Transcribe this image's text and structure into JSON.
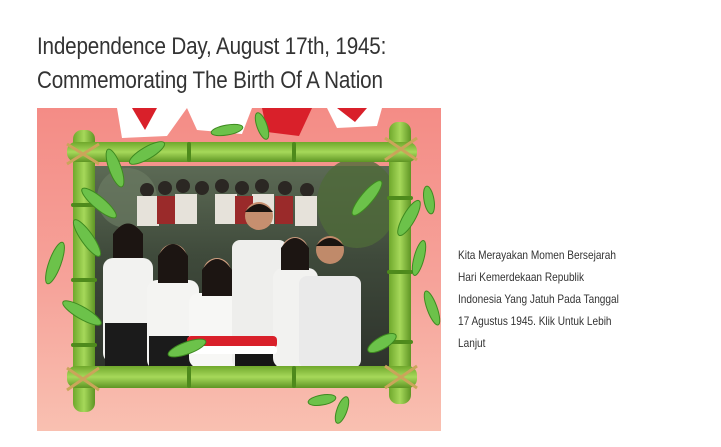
{
  "article": {
    "title_line1": "Independence Day, August 17th, 1945:",
    "title_line2": "Commemorating The Birth Of A Nation",
    "caption_lines": [
      "Kita Merayakan Momen Bersejarah",
      "Hari Kemerdekaan Republik",
      "Indonesia Yang Jatuh Pada Tanggal",
      "17 Agustus 1945. Klik Untuk Lebih",
      "Lanjut"
    ]
  },
  "image": {
    "subject": "students-holding-flag-in-bamboo-frame",
    "colors": {
      "background_top": "#f48c86",
      "background_bottom": "#f9c0b1",
      "bamboo": "#8dc63f",
      "flag_red": "#d9202a",
      "flag_white": "#ffffff"
    }
  }
}
